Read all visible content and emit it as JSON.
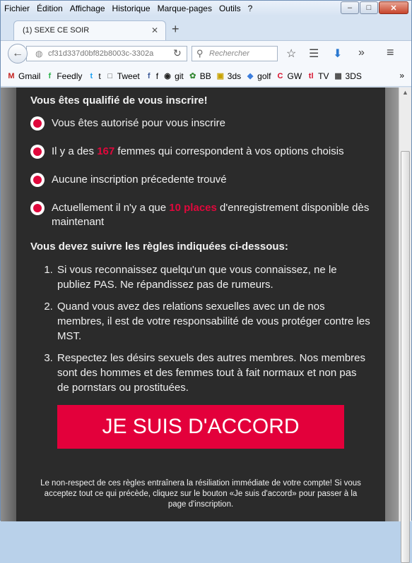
{
  "menu": [
    "Fichier",
    "Édition",
    "Affichage",
    "Historique",
    "Marque-pages",
    "Outils",
    "?"
  ],
  "window_controls": [
    "–",
    "□",
    "✕"
  ],
  "tab": {
    "title": "(1) SEXE CE SOIR",
    "close": "✕",
    "new": "+"
  },
  "nav": {
    "url": "cf31d337d0bf82b8003c-3302a",
    "search_placeholder": "Rechercher"
  },
  "bookmarks": [
    {
      "icon": "gmail-icon",
      "label": "Gmail",
      "color": "#c5221f",
      "glyph": "M"
    },
    {
      "icon": "feedly-icon",
      "label": "Feedly",
      "color": "#2bb24c",
      "glyph": "f"
    },
    {
      "icon": "twitter-icon",
      "label": "t",
      "color": "#1da1f2",
      "glyph": "t"
    },
    {
      "icon": "page-icon",
      "label": "Tweet",
      "color": "#555555",
      "glyph": "□"
    },
    {
      "icon": "facebook-icon",
      "label": "f",
      "color": "#3b5998",
      "glyph": "f"
    },
    {
      "icon": "github-icon",
      "label": "git",
      "color": "#222222",
      "glyph": "◉"
    },
    {
      "icon": "bb-icon",
      "label": "BB",
      "color": "#3a8c3a",
      "glyph": "✿"
    },
    {
      "icon": "3ds-icon",
      "label": "3ds",
      "color": "#c8a200",
      "glyph": "▣"
    },
    {
      "icon": "golf-icon",
      "label": "golf",
      "color": "#3b7ddd",
      "glyph": "◆"
    },
    {
      "icon": "gw-icon",
      "label": "GW",
      "color": "#d8102c",
      "glyph": "C"
    },
    {
      "icon": "tv-icon",
      "label": "TV",
      "color": "#d8102c",
      "glyph": "tl"
    },
    {
      "icon": "3ds-alt-icon",
      "label": "3DS",
      "color": "#444444",
      "glyph": "▦"
    }
  ],
  "bookmarks_more": "»",
  "main": {
    "qualified_title": "Vous êtes qualifié de vous inscrire!",
    "items": [
      {
        "pre": "Vous êtes autorisé pour vous inscrire",
        "hl": "",
        "post": ""
      },
      {
        "pre": "Il y a des ",
        "hl": "167",
        "post": " femmes qui correspondent à vos options choisis"
      },
      {
        "pre": "Aucune inscription précedente trouvé",
        "hl": "",
        "post": ""
      },
      {
        "pre": "Actuellement il n'y a que ",
        "hl": "10 places",
        "post": " d'enregistrement disponible dès maintenant"
      }
    ],
    "rules_title": "Vous devez suivre les règles indiquées ci-dessous:",
    "rules": [
      "Si vous reconnaissez quelqu'un que vous connaissez, ne le publiez PAS. Ne répandissez pas de rumeurs.",
      "Quand vous avez des relations sexuelles avec un de nos membres, il est de votre responsabilité de vous protéger contre les MST.",
      "Respectez les désirs sexuels des autres membres. Nos membres sont des hommes et des femmes tout à fait normaux et non pas de pornstars ou prostituées."
    ],
    "agree_button": "JE SUIS D'ACCORD",
    "disclaimer": "Le non-respect de ces règles entraînera la résiliation immédiate de votre compte! Si vous acceptez tout ce qui précède, cliquez sur le bouton «Je suis d'accord» pour passer à la page d'inscription."
  },
  "colors": {
    "accent": "#e3003b",
    "panel": "#2b2b2b"
  }
}
